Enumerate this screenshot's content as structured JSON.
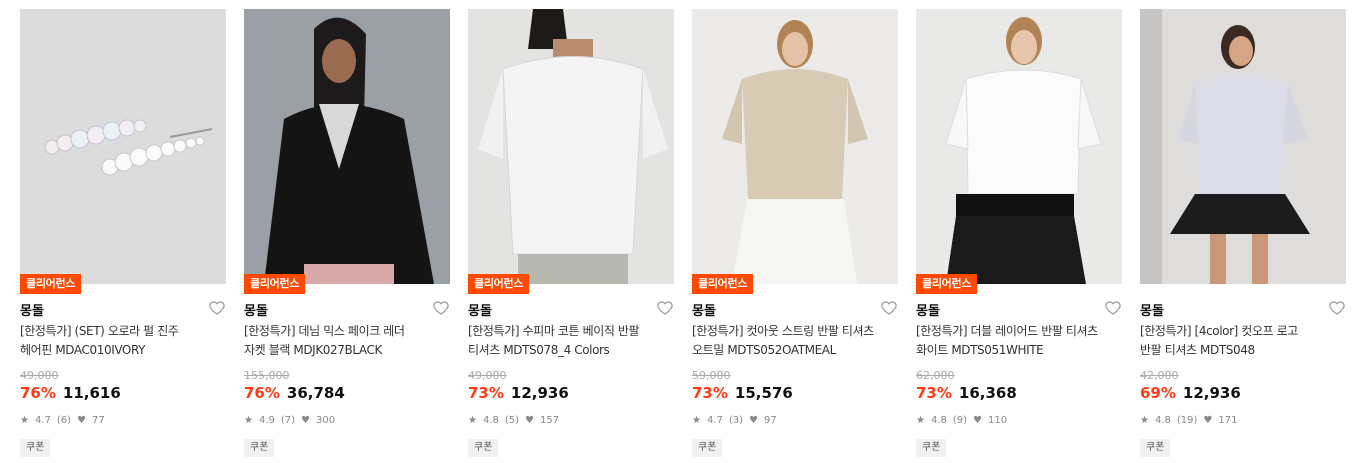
{
  "products": [
    {
      "badge": "클리어런스",
      "brand": "몽돌",
      "title_line1": "[한정특가] (SET) 오로라 펄 진주",
      "title_line2": "헤어핀 MDAC010IVORY",
      "original_price": "49,000",
      "discount": "76%",
      "price": "11,616",
      "rating": "4.7",
      "reviews": "(6)",
      "likes": "77",
      "coupon": "쿠폰",
      "image": "pearl hair pins"
    },
    {
      "badge": "클리어런스",
      "brand": "몽돌",
      "title_line1": "[한정특가] 데님 믹스 페이크 레더",
      "title_line2": "자켓 블랙 MDJK027BLACK",
      "original_price": "155,000",
      "discount": "76%",
      "price": "36,784",
      "rating": "4.9",
      "reviews": "(7)",
      "likes": "300",
      "coupon": "쿠폰",
      "image": "black leather jacket"
    },
    {
      "badge": "클리어런스",
      "brand": "몽돌",
      "title_line1": "[한정특가] 수피마 코튼 베이직 반팔",
      "title_line2": "티셔츠 MDTS078_4 Colors",
      "original_price": "49,000",
      "discount": "73%",
      "price": "12,936",
      "rating": "4.8",
      "reviews": "(5)",
      "likes": "157",
      "coupon": "쿠폰",
      "image": "white basic tee"
    },
    {
      "badge": "클리어런스",
      "brand": "몽돌",
      "title_line1": "[한정특가] 컷아웃 스트링 반팔 티셔츠",
      "title_line2": "오트밀 MDTS052OATMEAL",
      "original_price": "59,000",
      "discount": "73%",
      "price": "15,576",
      "rating": "4.7",
      "reviews": "(3)",
      "likes": "97",
      "coupon": "쿠폰",
      "image": "oatmeal cutout tee"
    },
    {
      "badge": "클리어런스",
      "brand": "몽돌",
      "title_line1": "[한정특가] 더블 레이어드 반팔 티셔츠",
      "title_line2": "화이트 MDTS051WHITE",
      "original_price": "62,000",
      "discount": "73%",
      "price": "16,368",
      "rating": "4.8",
      "reviews": "(9)",
      "likes": "110",
      "coupon": "쿠폰",
      "image": "white layered tee"
    },
    {
      "badge": "",
      "brand": "몽돌",
      "title_line1": "[한정특가] [4color] 컷오프 로고",
      "title_line2": "반팔 티셔츠 MDTS048",
      "original_price": "42,000",
      "discount": "69%",
      "price": "12,936",
      "rating": "4.8",
      "reviews": "(19)",
      "likes": "171",
      "coupon": "쿠폰",
      "image": "lavender logo tee"
    }
  ],
  "colors": {
    "badge": "#ff4800",
    "discount": "#ff3b16"
  }
}
